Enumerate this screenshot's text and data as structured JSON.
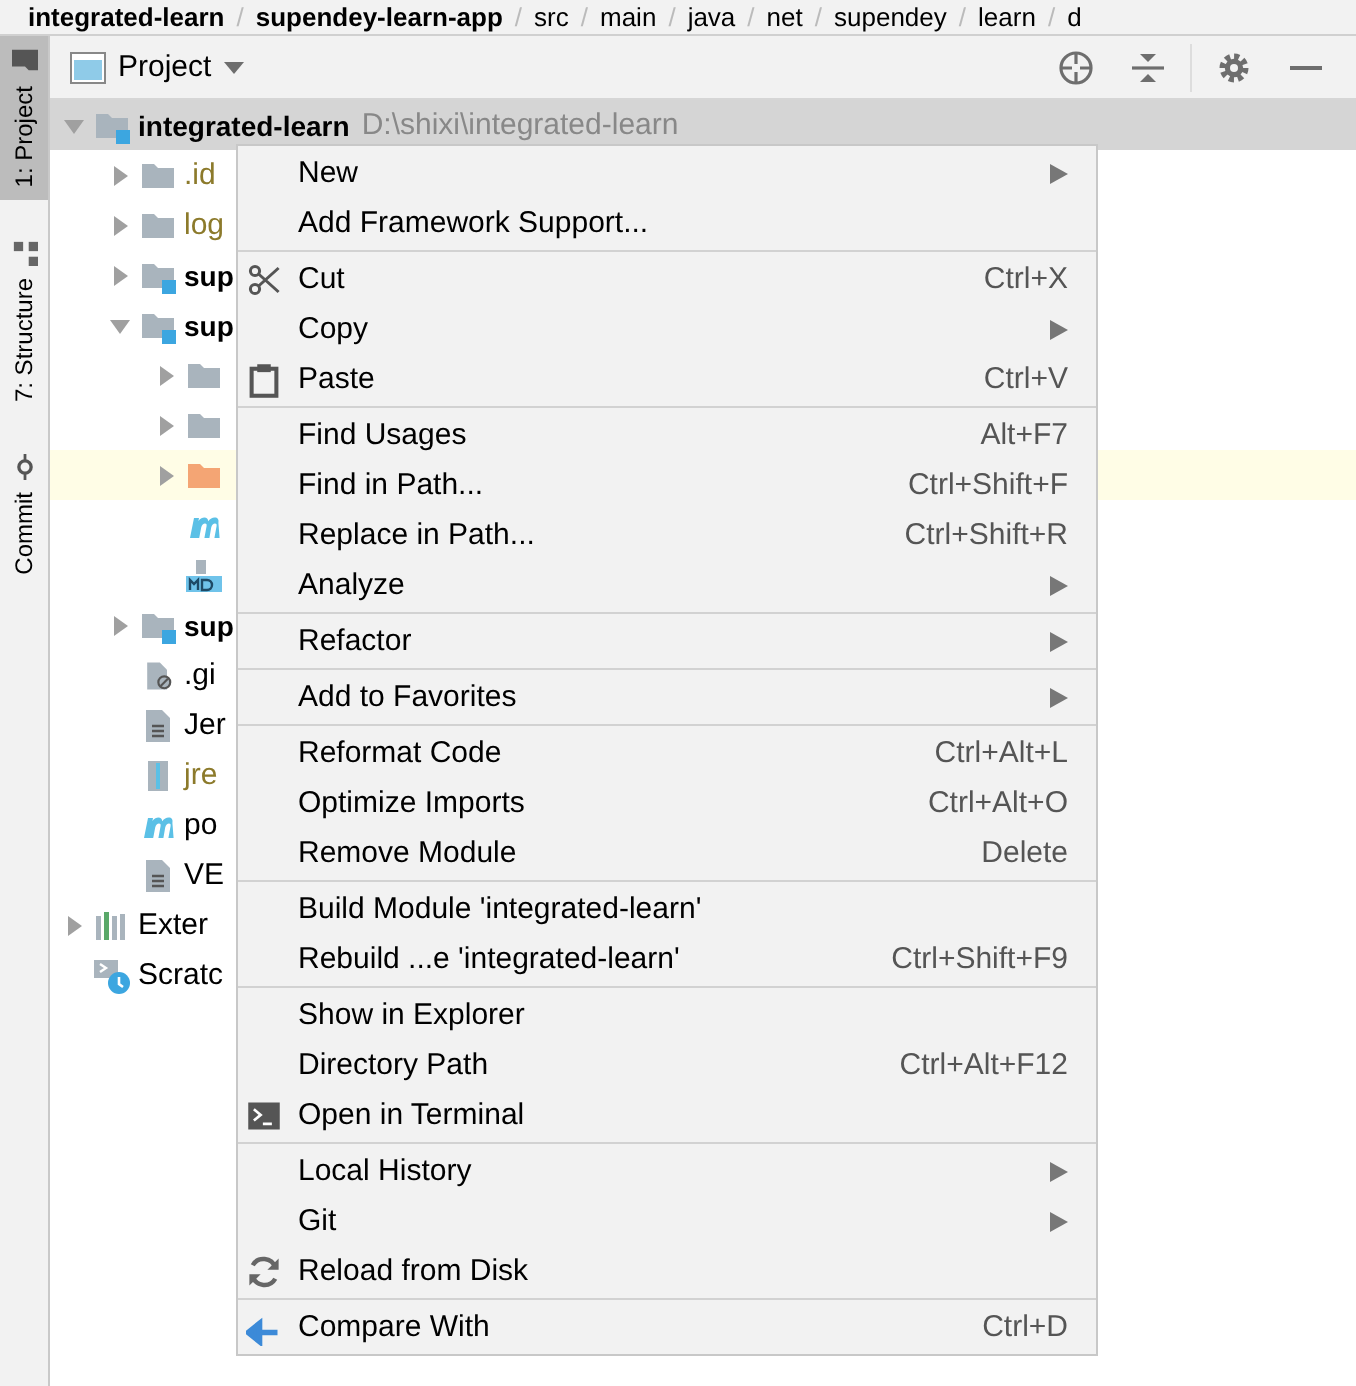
{
  "breadcrumbs": [
    {
      "kind": "crumb",
      "label": "integrated-learn",
      "bold": true
    },
    {
      "kind": "separator",
      "label": "/"
    },
    {
      "kind": "crumb",
      "label": "supendey-learn-app",
      "bold": true
    },
    {
      "kind": "separator",
      "label": "/"
    },
    {
      "kind": "crumb",
      "label": "src",
      "bold": false
    },
    {
      "kind": "separator",
      "label": "/"
    },
    {
      "kind": "crumb",
      "label": "main",
      "bold": false
    },
    {
      "kind": "separator",
      "label": "/"
    },
    {
      "kind": "crumb",
      "label": "java",
      "bold": false
    },
    {
      "kind": "separator",
      "label": "/"
    },
    {
      "kind": "crumb",
      "label": "net",
      "bold": false
    },
    {
      "kind": "separator",
      "label": "/"
    },
    {
      "kind": "crumb",
      "label": "supendey",
      "bold": false
    },
    {
      "kind": "separator",
      "label": "/"
    },
    {
      "kind": "crumb",
      "label": "learn",
      "bold": false
    },
    {
      "kind": "separator",
      "label": "/"
    },
    {
      "kind": "crumb",
      "label": "d",
      "bold": false
    }
  ],
  "side_tabs": [
    {
      "label": "1: Project",
      "kind": "project",
      "selected": true
    },
    {
      "label": "7: Structure",
      "kind": "structure",
      "selected": false
    },
    {
      "label": "Commit",
      "kind": "commit",
      "selected": false
    }
  ],
  "tool_window": {
    "title": "Project"
  },
  "tree": [
    {
      "label": "integrated-learn",
      "path": "D:\\shixi\\integrated-learn",
      "kind": "module",
      "bold": true,
      "color": "#000000",
      "expanded": true,
      "selected": true,
      "current": false,
      "children": [
        {
          "label": ".id",
          "kind": "folder",
          "bold": false,
          "color": "#8c7a2b",
          "expanded": false,
          "selected": false,
          "current": false
        },
        {
          "label": "log",
          "kind": "folder",
          "bold": false,
          "color": "#8c7a2b",
          "expanded": false,
          "selected": false,
          "current": false
        },
        {
          "label": "sup",
          "kind": "module",
          "bold": true,
          "color": "#000000",
          "expanded": false,
          "selected": false,
          "current": false
        },
        {
          "label": "sup",
          "kind": "module",
          "bold": true,
          "color": "#000000",
          "expanded": true,
          "selected": false,
          "current": false,
          "children": [
            {
              "kind": "folder",
              "expanded": false,
              "selected": false,
              "current": false
            },
            {
              "kind": "folder",
              "expanded": false,
              "selected": false,
              "current": false
            },
            {
              "kind": "resources",
              "expanded": false,
              "selected": false,
              "current": true
            },
            {
              "kind": "maven",
              "selected": false,
              "current": false
            },
            {
              "kind": "markdown",
              "selected": false,
              "current": false
            }
          ]
        },
        {
          "label": "sup",
          "kind": "module",
          "bold": true,
          "color": "#000000",
          "expanded": false,
          "selected": false,
          "current": false
        },
        {
          "label": ".gi",
          "kind": "ignore",
          "bold": false,
          "color": "#000000",
          "selected": false,
          "current": false
        },
        {
          "label": "Jer",
          "kind": "file",
          "bold": false,
          "color": "#000000",
          "selected": false,
          "current": false
        },
        {
          "label": "jre",
          "kind": "archive",
          "bold": false,
          "color": "#8c7a2b",
          "selected": false,
          "current": false
        },
        {
          "label": "po",
          "kind": "maven",
          "bold": false,
          "color": "#000000",
          "selected": false,
          "current": false
        },
        {
          "label": "VE",
          "kind": "file",
          "bold": false,
          "color": "#000000",
          "selected": false,
          "current": false
        }
      ]
    },
    {
      "label": "Exter",
      "kind": "libraries",
      "bold": false,
      "color": "#000000",
      "expanded": false,
      "selected": false,
      "current": false
    },
    {
      "label": "Scratc",
      "kind": "scratches",
      "bold": false,
      "color": "#000000",
      "selected": false,
      "current": false
    }
  ],
  "context_menu": {
    "groups": [
      [
        {
          "label": "New",
          "submenu": true
        },
        {
          "label": "Add Framework Support...",
          "submenu": false
        }
      ],
      [
        {
          "label": "Cut",
          "shortcut": "Ctrl+X",
          "kind": "cut",
          "submenu": false
        },
        {
          "label": "Copy",
          "submenu": true
        },
        {
          "label": "Paste",
          "shortcut": "Ctrl+V",
          "kind": "paste",
          "submenu": false
        }
      ],
      [
        {
          "label": "Find Usages",
          "shortcut": "Alt+F7",
          "submenu": false
        },
        {
          "label": "Find in Path...",
          "shortcut": "Ctrl+Shift+F",
          "submenu": false
        },
        {
          "label": "Replace in Path...",
          "shortcut": "Ctrl+Shift+R",
          "submenu": false
        },
        {
          "label": "Analyze",
          "submenu": true
        }
      ],
      [
        {
          "label": "Refactor",
          "submenu": true
        }
      ],
      [
        {
          "label": "Add to Favorites",
          "submenu": true
        }
      ],
      [
        {
          "label": "Reformat Code",
          "shortcut": "Ctrl+Alt+L",
          "submenu": false
        },
        {
          "label": "Optimize Imports",
          "shortcut": "Ctrl+Alt+O",
          "submenu": false
        },
        {
          "label": "Remove Module",
          "shortcut": "Delete",
          "submenu": false
        }
      ],
      [
        {
          "label": "Build Module 'integrated-learn'",
          "submenu": false
        },
        {
          "label": "Rebuild ...e 'integrated-learn'",
          "shortcut": "Ctrl+Shift+F9",
          "submenu": false
        }
      ],
      [
        {
          "label": "Show in Explorer",
          "submenu": false
        },
        {
          "label": "Directory Path",
          "shortcut": "Ctrl+Alt+F12",
          "submenu": false
        },
        {
          "label": "Open in Terminal",
          "kind": "terminal",
          "submenu": false
        }
      ],
      [
        {
          "label": "Local History",
          "submenu": true
        },
        {
          "label": "Git",
          "submenu": true
        },
        {
          "label": "Reload from Disk",
          "kind": "reload",
          "submenu": false
        }
      ],
      [
        {
          "label": "Compare With",
          "shortcut": "Ctrl+D",
          "kind": "compare",
          "submenu": false
        }
      ]
    ]
  }
}
